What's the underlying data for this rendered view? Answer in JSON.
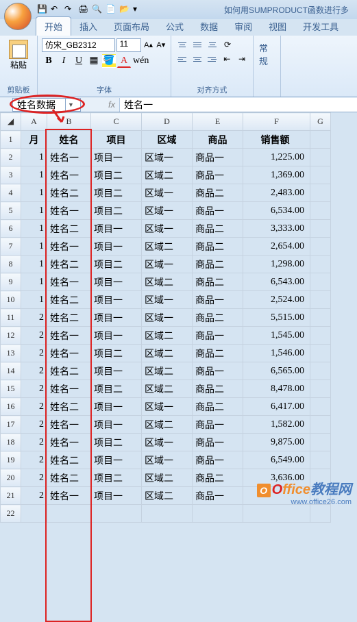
{
  "title": "如何用SUMPRODUCT函数进行多",
  "tabs": [
    "开始",
    "插入",
    "页面布局",
    "公式",
    "数据",
    "审阅",
    "视图",
    "开发工具"
  ],
  "ribbon": {
    "clipboard_label": "剪贴板",
    "paste_label": "粘贴",
    "font_label": "字体",
    "font_name": "仿宋_GB2312",
    "font_size": "11",
    "align_label": "对齐方式",
    "number_label": "常规"
  },
  "name_box": "姓名数据",
  "formula_value": "姓名一",
  "columns": [
    "A",
    "B",
    "C",
    "D",
    "E",
    "F",
    "G"
  ],
  "headers": {
    "a": "月",
    "b": "姓名",
    "c": "项目",
    "d": "区域",
    "e": "商品",
    "f": "销售额"
  },
  "rows": [
    {
      "n": 1,
      "a": "1",
      "b": "姓名一",
      "c": "项目一",
      "d": "区域一",
      "e": "商品一",
      "f": "1,225.00"
    },
    {
      "n": 2,
      "a": "1",
      "b": "姓名一",
      "c": "项目二",
      "d": "区域二",
      "e": "商品一",
      "f": "1,369.00"
    },
    {
      "n": 3,
      "a": "1",
      "b": "姓名二",
      "c": "项目二",
      "d": "区域一",
      "e": "商品二",
      "f": "2,483.00"
    },
    {
      "n": 4,
      "a": "1",
      "b": "姓名一",
      "c": "项目二",
      "d": "区域一",
      "e": "商品一",
      "f": "6,534.00"
    },
    {
      "n": 5,
      "a": "1",
      "b": "姓名二",
      "c": "项目一",
      "d": "区域一",
      "e": "商品二",
      "f": "3,333.00"
    },
    {
      "n": 6,
      "a": "1",
      "b": "姓名一",
      "c": "项目一",
      "d": "区域二",
      "e": "商品二",
      "f": "2,654.00"
    },
    {
      "n": 7,
      "a": "1",
      "b": "姓名二",
      "c": "项目二",
      "d": "区域一",
      "e": "商品二",
      "f": "1,298.00"
    },
    {
      "n": 8,
      "a": "1",
      "b": "姓名一",
      "c": "项目一",
      "d": "区域二",
      "e": "商品二",
      "f": "6,543.00"
    },
    {
      "n": 9,
      "a": "1",
      "b": "姓名二",
      "c": "项目一",
      "d": "区域一",
      "e": "商品一",
      "f": "2,524.00"
    },
    {
      "n": 10,
      "a": "2",
      "b": "姓名二",
      "c": "项目一",
      "d": "区域一",
      "e": "商品二",
      "f": "5,515.00"
    },
    {
      "n": 11,
      "a": "2",
      "b": "姓名一",
      "c": "项目一",
      "d": "区域二",
      "e": "商品一",
      "f": "1,545.00"
    },
    {
      "n": 12,
      "a": "2",
      "b": "姓名一",
      "c": "项目二",
      "d": "区域二",
      "e": "商品二",
      "f": "1,546.00"
    },
    {
      "n": 13,
      "a": "2",
      "b": "姓名二",
      "c": "项目一",
      "d": "区域二",
      "e": "商品一",
      "f": "6,565.00"
    },
    {
      "n": 14,
      "a": "2",
      "b": "姓名一",
      "c": "项目二",
      "d": "区域二",
      "e": "商品二",
      "f": "8,478.00"
    },
    {
      "n": 15,
      "a": "2",
      "b": "姓名二",
      "c": "项目一",
      "d": "区域一",
      "e": "商品二",
      "f": "6,417.00"
    },
    {
      "n": 16,
      "a": "2",
      "b": "姓名一",
      "c": "项目一",
      "d": "区域二",
      "e": "商品一",
      "f": "1,582.00"
    },
    {
      "n": 17,
      "a": "2",
      "b": "姓名一",
      "c": "项目二",
      "d": "区域一",
      "e": "商品一",
      "f": "9,875.00"
    },
    {
      "n": 18,
      "a": "2",
      "b": "姓名二",
      "c": "项目一",
      "d": "区域一",
      "e": "商品一",
      "f": "6,549.00"
    },
    {
      "n": 19,
      "a": "2",
      "b": "姓名二",
      "c": "项目二",
      "d": "区域二",
      "e": "商品二",
      "f": "3,636.00"
    },
    {
      "n": 20,
      "a": "2",
      "b": "姓名一",
      "c": "项目一",
      "d": "区域二",
      "e": "商品一",
      "f": ""
    },
    {
      "n": 21,
      "a": "",
      "b": "",
      "c": "",
      "d": "",
      "e": "",
      "f": ""
    }
  ],
  "watermark": {
    "brand_o": "O",
    "brand_ff": "ffice",
    "brand_rest": "教程网",
    "url": "www.office26.com"
  }
}
